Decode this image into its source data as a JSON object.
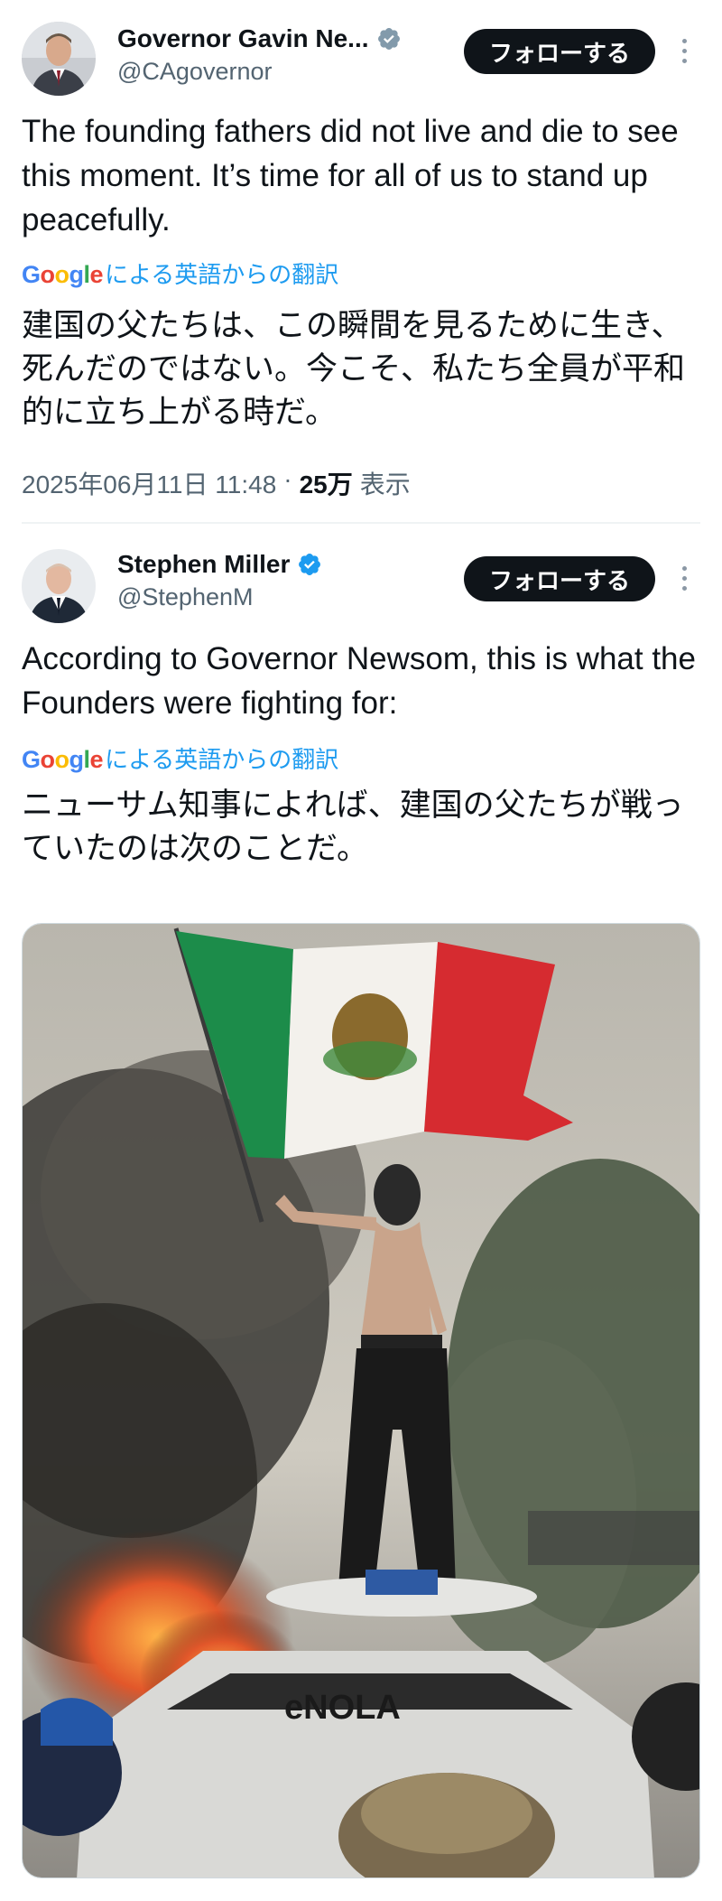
{
  "tweets": [
    {
      "display_name": "Governor Gavin Ne...",
      "handle": "@CAgovernor",
      "follow_label": "フォローする",
      "body": "The founding fathers did not live and die to see this moment. It’s time for all of us to stand up peacefully.",
      "translation_link": "による英語からの翻訳",
      "translation": "建国の父たちは、この瞬間を見るために生き、死んだのではない。今こそ、私たち全員が平和的に立ち上がる時だ。",
      "timestamp": "2025年06月11日 11:48",
      "separator": "·",
      "views_count": "25万",
      "views_label": "表示"
    },
    {
      "display_name": "Stephen Miller",
      "handle": "@StephenM",
      "follow_label": "フォローする",
      "body": "According to Governor Newsom, this is what the Founders were fighting for:",
      "translation_link": "による英語からの翻訳",
      "translation": "ニューサム知事によれば、建国の父たちが戦っていたのは次のことだ。"
    }
  ],
  "google_logo": "Google",
  "colors": {
    "verified_blue": "#1d9bf0",
    "verified_gray": "#829aab",
    "link_blue": "#1d9bf0",
    "text_primary": "#0f1419",
    "text_secondary": "#536471"
  },
  "icons": {
    "verified_gray": "verified-badge-gray-icon",
    "verified_blue": "verified-badge-blue-icon",
    "more": "more-options-icon"
  }
}
